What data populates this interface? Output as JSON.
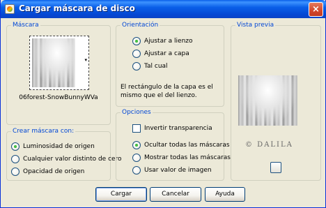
{
  "window": {
    "title": "Cargar máscara de disco",
    "close_glyph": "×"
  },
  "mascara": {
    "legend": "Máscara",
    "filename": "06forest-SnowBunnyWVa"
  },
  "orientacion": {
    "legend": "Orientación",
    "options": [
      {
        "label": "Ajustar a lienzo",
        "selected": true
      },
      {
        "label": "Ajustar a capa",
        "selected": false
      },
      {
        "label": "Tal cual",
        "selected": false
      }
    ],
    "description": "El rectángulo de la capa es el mismo que el del lienzo."
  },
  "vista_previa": {
    "legend": "Vista previa",
    "watermark": "© DALILA"
  },
  "crear": {
    "legend": "Crear máscara con:",
    "options": [
      {
        "label": "Luminosidad de origen",
        "selected": true
      },
      {
        "label": "Cualquier valor distinto de cero",
        "selected": false
      },
      {
        "label": "Opacidad de origen",
        "selected": false
      }
    ]
  },
  "opciones": {
    "legend": "Opciones",
    "invert_label": "Invertir transparencia",
    "invert_checked": false,
    "options": [
      {
        "label": "Ocultar todas las máscaras",
        "selected": true
      },
      {
        "label": "Mostrar todas las máscaras",
        "selected": false
      },
      {
        "label": "Usar valor de imagen",
        "selected": false
      }
    ]
  },
  "buttons": {
    "load": "Cargar",
    "cancel": "Cancelar",
    "help": "Ayuda"
  },
  "colors": {
    "title_bar": "#0A5FE8",
    "legend_text": "#0046D5",
    "dialog_bg": "#ECE9D8"
  }
}
